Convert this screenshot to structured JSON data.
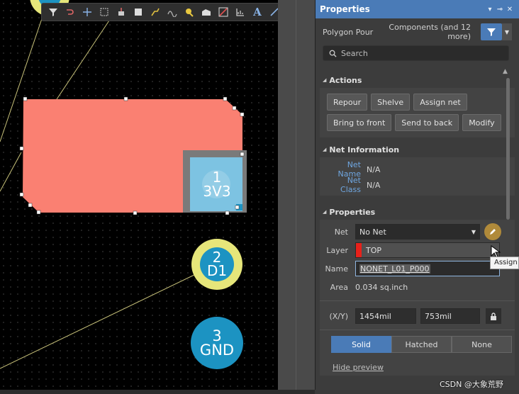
{
  "toolbar": {
    "icons": [
      "filter-icon",
      "route-icon",
      "crosshair-icon",
      "select-rect-icon",
      "place-component-icon",
      "fill-icon",
      "route-track-icon",
      "arc-icon",
      "pad-icon",
      "polygon-icon",
      "keepout-icon",
      "report-icon",
      "text-icon",
      "line-icon"
    ],
    "text_tool_glyph": "A"
  },
  "canvas": {
    "pads": [
      {
        "number": "1",
        "net": "3V3"
      },
      {
        "number": "2",
        "net": "D1"
      },
      {
        "number": "3",
        "net": "GND"
      }
    ],
    "colors": {
      "polygon": "#fa8072",
      "pad_yellow": "#e6e67a",
      "pad_blue": "#1c93c2",
      "pad_selected": "#7dc3e2",
      "track": "#c8c27a"
    }
  },
  "panel": {
    "title": "Properties",
    "object_type": "Polygon Pour",
    "filter_summary": "Components (and 12 more)",
    "search_placeholder": "Search",
    "sections": {
      "actions": {
        "title": "Actions",
        "row1": [
          "Repour",
          "Shelve",
          "Assign net"
        ],
        "row2": [
          "Bring to front",
          "Send to back",
          "Modify"
        ]
      },
      "net_info": {
        "title": "Net Information",
        "net_name_label": "Net Name",
        "net_name_value": "N/A",
        "net_class_label": "Net Class",
        "net_class_value": "N/A"
      },
      "properties": {
        "title": "Properties",
        "net_label": "Net",
        "net_value": "No Net",
        "layer_label": "Layer",
        "layer_value": "TOP",
        "layer_color": "#e8211a",
        "name_label": "Name",
        "name_value": "NONET_L01_P000",
        "area_label": "Area",
        "area_value": "0.034 sq.inch",
        "xy_label": "(X/Y)",
        "x_value": "1454mil",
        "y_value": "753mil",
        "fill_modes": [
          "Solid",
          "Hatched",
          "None"
        ],
        "active_fill_mode": "Solid",
        "hide_preview": "Hide preview"
      }
    },
    "tooltip": "Assign Net",
    "accent": "#4a7bb7"
  },
  "watermark": "CSDN @大象荒野"
}
